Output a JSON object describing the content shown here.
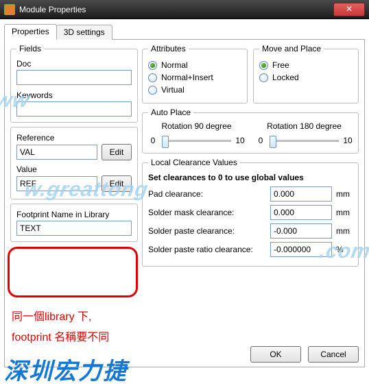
{
  "window": {
    "title": "Module Properties"
  },
  "tabs": {
    "properties": "Properties",
    "threed": "3D settings"
  },
  "fields": {
    "legend": "Fields",
    "doc_label": "Doc",
    "doc_value": "",
    "keywords_label": "Keywords",
    "keywords_value": "",
    "reference_label": "Reference",
    "reference_value": "VAL",
    "value_label": "Value",
    "value_value": "REF",
    "edit": "Edit"
  },
  "footprint": {
    "label": "Footprint Name in Library",
    "value": "TEXT"
  },
  "attributes": {
    "legend": "Attributes",
    "normal": "Normal",
    "normal_insert": "Normal+Insert",
    "virtual": "Virtual",
    "selected": "normal"
  },
  "moveplace": {
    "legend": "Move and Place",
    "free": "Free",
    "locked": "Locked",
    "selected": "free"
  },
  "autoplace": {
    "legend": "Auto Place",
    "rot90_label": "Rotation 90 degree",
    "rot180_label": "Rotation 180 degree",
    "min": "0",
    "max": "10",
    "rot90_value": 0,
    "rot180_value": 0
  },
  "clearance": {
    "legend": "Local Clearance Values",
    "heading": "Set clearances to 0 to use global values",
    "pad_label": "Pad clearance:",
    "pad_value": "0.000",
    "pad_unit": "mm",
    "mask_label": "Solder mask clearance:",
    "mask_value": "0.000",
    "mask_unit": "mm",
    "paste_label": "Solder paste clearance:",
    "paste_value": "-0.000",
    "paste_unit": "mm",
    "ratio_label": "Solder paste ratio clearance:",
    "ratio_value": "-0.000000",
    "ratio_unit": "%"
  },
  "buttons": {
    "ok": "OK",
    "cancel": "Cancel"
  },
  "annotations": {
    "line1": "同一個library 下,",
    "line2": "footprint 名稱要不同"
  },
  "watermarks": {
    "url_left": "ww",
    "url_right": ".com",
    "url_mid": "w.greattong",
    "brand": "深圳宏力捷"
  }
}
